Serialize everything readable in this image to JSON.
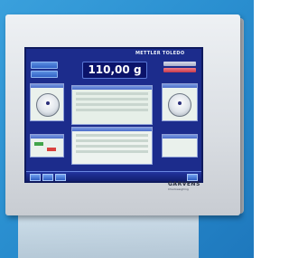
{
  "header": {
    "brand": "METTLER TOLEDO"
  },
  "display": {
    "weight": "110,00 g"
  },
  "footer": {
    "logo": "GARVENS",
    "logo_sub": "Checkweighing"
  },
  "colors": {
    "screen_bg": "#1c2c8c",
    "panel_bg": "#eaf1ec",
    "background": "#2a8fd0"
  }
}
